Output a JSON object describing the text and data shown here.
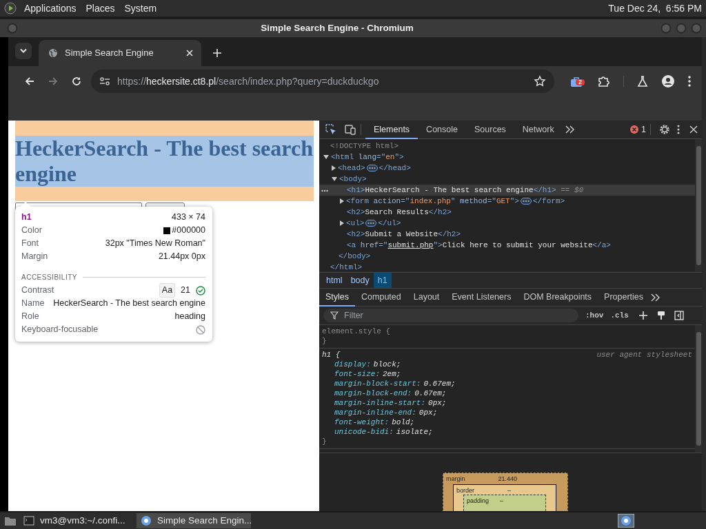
{
  "top_panel": {
    "menus": [
      {
        "label": "Applications"
      },
      {
        "label": "Places"
      },
      {
        "label": "System"
      }
    ],
    "clock": "Tue Dec 24,  6:56 PM"
  },
  "window": {
    "title": "Simple Search Engine - Chromium"
  },
  "browser": {
    "tabs": [
      {
        "title": "Simple Search Engine",
        "selected": true
      }
    ],
    "nav_buttons": [
      {
        "kind": "back",
        "disabled": false
      },
      {
        "kind": "forward",
        "disabled": true
      },
      {
        "kind": "reload",
        "disabled": false
      }
    ],
    "url": {
      "scheme": "https://",
      "host": "heckersite.ct8.pl",
      "path": "/search/index.php?query=duckduckgo"
    },
    "extension_badge": "2"
  },
  "page": {
    "heading": "HeckerSearch - The best search engine"
  },
  "inspect_tooltip": {
    "tag": "h1",
    "size": "433 × 74",
    "rows": [
      {
        "label": "Color",
        "value": "#000000",
        "color": "#000000"
      },
      {
        "label": "Font",
        "value": "32px \"Times New Roman\""
      },
      {
        "label": "Margin",
        "value": "21.44px 0px"
      }
    ],
    "section": "ACCESSIBILITY",
    "accessibility": [
      {
        "kind": "contrast",
        "label": "Contrast",
        "sample": "Aa",
        "value": "21",
        "passes": true
      },
      {
        "kind": "text",
        "label": "Name",
        "value": "HeckerSearch - The best search engine"
      },
      {
        "kind": "text",
        "label": "Role",
        "value": "heading"
      },
      {
        "kind": "focusable",
        "label": "Keyboard-focusable",
        "focusable": false
      }
    ]
  },
  "devtools": {
    "tabs": [
      {
        "label": "Elements",
        "selected": true
      },
      {
        "label": "Console",
        "selected": false
      },
      {
        "label": "Sources",
        "selected": false
      },
      {
        "label": "Network",
        "selected": false
      }
    ],
    "error_count": "1",
    "dom_tree": [
      {
        "selected": false,
        "tokens": [
          {
            "kind": "doc",
            "t": "<!DOCTYPE html>"
          }
        ]
      },
      {
        "selected": false,
        "expanded": true,
        "tokens": [
          {
            "kind": "tag",
            "t": "<html"
          },
          {
            "kind": "attr",
            "t": " lang"
          },
          {
            "kind": "tag",
            "t": "=\""
          },
          {
            "kind": "val",
            "t": "en"
          },
          {
            "kind": "tag",
            "t": "\">"
          }
        ],
        "close": [
          {
            "kind": "tag",
            "t": "</html>"
          }
        ],
        "children": [
          {
            "selected": false,
            "expanded": false,
            "tokens": [
              {
                "kind": "tag",
                "t": "<head>"
              },
              {
                "kind": "ell"
              },
              {
                "kind": "tag",
                "t": "</head>"
              }
            ]
          },
          {
            "selected": false,
            "expanded": true,
            "tokens": [
              {
                "kind": "tag",
                "t": "<body>"
              }
            ],
            "close": [
              {
                "kind": "tag",
                "t": "</body>"
              }
            ],
            "children": [
              {
                "selected": true,
                "tokens": [
                  {
                    "kind": "tag",
                    "t": "<h1>"
                  },
                  {
                    "kind": "text",
                    "t": "HeckerSearch - The best search engine"
                  },
                  {
                    "kind": "tag",
                    "t": "</h1>"
                  },
                  {
                    "kind": "com",
                    "t": " == $0"
                  }
                ]
              },
              {
                "selected": false,
                "expanded": false,
                "tokens": [
                  {
                    "kind": "tag",
                    "t": "<form"
                  },
                  {
                    "kind": "attr",
                    "t": " action"
                  },
                  {
                    "kind": "tag",
                    "t": "=\""
                  },
                  {
                    "kind": "val",
                    "t": "index.php"
                  },
                  {
                    "kind": "tag",
                    "t": "\""
                  },
                  {
                    "kind": "attr",
                    "t": " method"
                  },
                  {
                    "kind": "tag",
                    "t": "=\""
                  },
                  {
                    "kind": "val",
                    "t": "GET"
                  },
                  {
                    "kind": "tag",
                    "t": "\">"
                  },
                  {
                    "kind": "ell"
                  },
                  {
                    "kind": "tag",
                    "t": "</form>"
                  }
                ]
              },
              {
                "selected": false,
                "tokens": [
                  {
                    "kind": "tag",
                    "t": "<h2>"
                  },
                  {
                    "kind": "text",
                    "t": "Search Results"
                  },
                  {
                    "kind": "tag",
                    "t": "</h2>"
                  }
                ]
              },
              {
                "selected": false,
                "expanded": false,
                "tokens": [
                  {
                    "kind": "tag",
                    "t": "<ul>"
                  },
                  {
                    "kind": "ell"
                  },
                  {
                    "kind": "tag",
                    "t": "</ul>"
                  }
                ]
              },
              {
                "selected": false,
                "tokens": [
                  {
                    "kind": "tag",
                    "t": "<h2>"
                  },
                  {
                    "kind": "text",
                    "t": "Submit a Website"
                  },
                  {
                    "kind": "tag",
                    "t": "</h2>"
                  }
                ]
              },
              {
                "selected": false,
                "tokens": [
                  {
                    "kind": "tag",
                    "t": "<a"
                  },
                  {
                    "kind": "attr",
                    "t": " href"
                  },
                  {
                    "kind": "tag",
                    "t": "=\""
                  },
                  {
                    "kind": "link",
                    "t": "submit.php"
                  },
                  {
                    "kind": "tag",
                    "t": "\">"
                  },
                  {
                    "kind": "text",
                    "t": "Click here to submit your website"
                  },
                  {
                    "kind": "tag",
                    "t": "</a>"
                  }
                ]
              }
            ]
          }
        ]
      }
    ],
    "breadcrumbs": [
      {
        "label": "html",
        "selected": false
      },
      {
        "label": "body",
        "selected": false
      },
      {
        "label": "h1",
        "selected": true
      }
    ],
    "panel_tabs": [
      {
        "label": "Styles",
        "selected": true
      },
      {
        "label": "Computed",
        "selected": false
      },
      {
        "label": "Layout",
        "selected": false
      },
      {
        "label": "Event Listeners",
        "selected": false
      },
      {
        "label": "DOM Breakpoints",
        "selected": false
      },
      {
        "label": "Properties",
        "selected": false
      }
    ],
    "filter": {
      "placeholder": "Filter"
    },
    "style_buttons": [
      ":hov",
      ".cls"
    ],
    "rules": [
      {
        "selector": "element.style {",
        "close": "}"
      },
      {
        "selector": "h1 {",
        "origin": "user agent stylesheet",
        "close": "}",
        "declarations": [
          {
            "property": "display:",
            "value": "block;"
          },
          {
            "property": "font-size:",
            "value": "2em;"
          },
          {
            "property": "margin-block-start:",
            "value": "0.67em;"
          },
          {
            "property": "margin-block-end:",
            "value": "0.67em;"
          },
          {
            "property": "margin-inline-start:",
            "value": "0px;"
          },
          {
            "property": "margin-inline-end:",
            "value": "0px;"
          },
          {
            "property": "font-weight:",
            "value": "bold;"
          },
          {
            "property": "unicode-bidi:",
            "value": "isolate;"
          }
        ]
      }
    ],
    "box_model": {
      "margin": {
        "label": "margin",
        "value": "21.440"
      },
      "border": {
        "label": "border",
        "value": "–"
      },
      "padding": {
        "label": "padding",
        "value": "–"
      }
    }
  },
  "taskbar": {
    "tasks": [
      {
        "kind": "terminal",
        "label": "vm3@vm3:~/.confi...",
        "selected": false
      },
      {
        "kind": "browser",
        "label": "Simple Search Engin...",
        "selected": true
      }
    ]
  }
}
